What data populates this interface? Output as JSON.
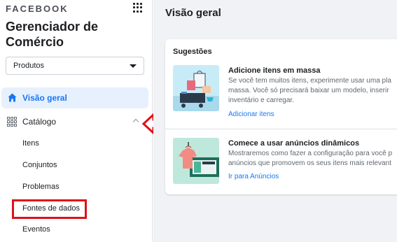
{
  "sidebar": {
    "brand": "FACEBOOK",
    "app_title": "Gerenciador de Comércio",
    "dropdown": {
      "value": "Produtos"
    },
    "nav": {
      "overview_label": "Visão geral",
      "catalog_label": "Catálogo",
      "sub_items": [
        "Itens",
        "Conjuntos",
        "Problemas",
        "Fontes de dados",
        "Eventos"
      ]
    }
  },
  "main": {
    "page_title": "Visão geral",
    "suggestions": {
      "heading": "Sugestões",
      "items": [
        {
          "title": "Adicione itens em massa",
          "desc_lines": [
            "Se você tem muitos itens, experimente usar uma pla",
            "massa. Você só precisará baixar um modelo, inserir",
            "inventário e carregar."
          ],
          "link": "Adicionar itens"
        },
        {
          "title": "Comece a usar anúncios dinâmicos",
          "desc_lines": [
            "Mostraremos como fazer a configuração para você p",
            "anúncios que promovem os seus itens mais relevant"
          ],
          "link": "Ir para Anúncios"
        }
      ]
    }
  },
  "colors": {
    "accent": "#1877f2",
    "active_bg": "#e7f0fd",
    "annotation_red": "#e0101a",
    "main_bg": "#f0f2f5"
  },
  "icons": [
    "apps-grid-icon",
    "home-icon",
    "catalog-grid-icon",
    "chevron-up-icon",
    "caret-down-icon"
  ]
}
